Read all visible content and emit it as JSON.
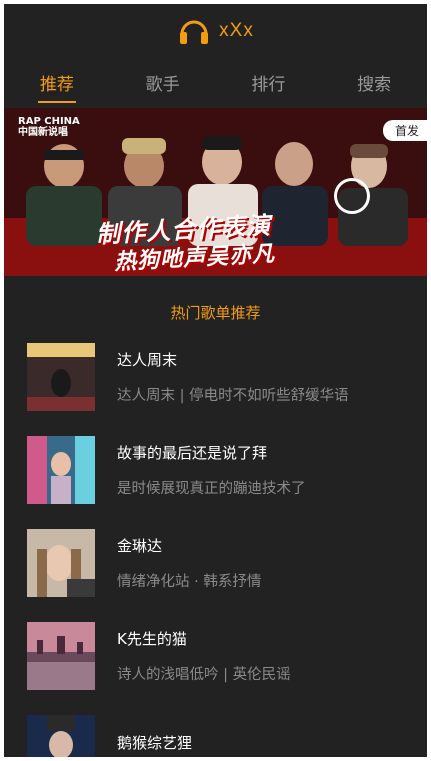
{
  "header": {
    "title": "xXx",
    "logo_icon": "headphones-icon",
    "accent_color": "#f39c12"
  },
  "tabs": [
    {
      "label": "推荐",
      "active": true
    },
    {
      "label": "歌手",
      "active": false
    },
    {
      "label": "排行",
      "active": false
    },
    {
      "label": "搜索",
      "active": false
    }
  ],
  "banner": {
    "brand_line1": "RAP CHINA",
    "brand_line2": "中国新说唱",
    "tag": "首发",
    "headline": "制作人合作表演",
    "subline": "热狗吔声吴亦凡"
  },
  "section": {
    "title": "热门歌单推荐"
  },
  "playlists": [
    {
      "title": "达人周末",
      "desc": "达人周末 | 停电时不如听些舒缓华语"
    },
    {
      "title": "故事的最后还是说了拜",
      "desc": "是时候展现真正的蹦迪技术了"
    },
    {
      "title": "金琳达",
      "desc": "情绪净化站 · 韩系抒情"
    },
    {
      "title": "K先生的猫",
      "desc": "诗人的浅唱低吟 | 英伦民谣"
    },
    {
      "title": "鹅猴综艺狸",
      "desc": ""
    }
  ]
}
